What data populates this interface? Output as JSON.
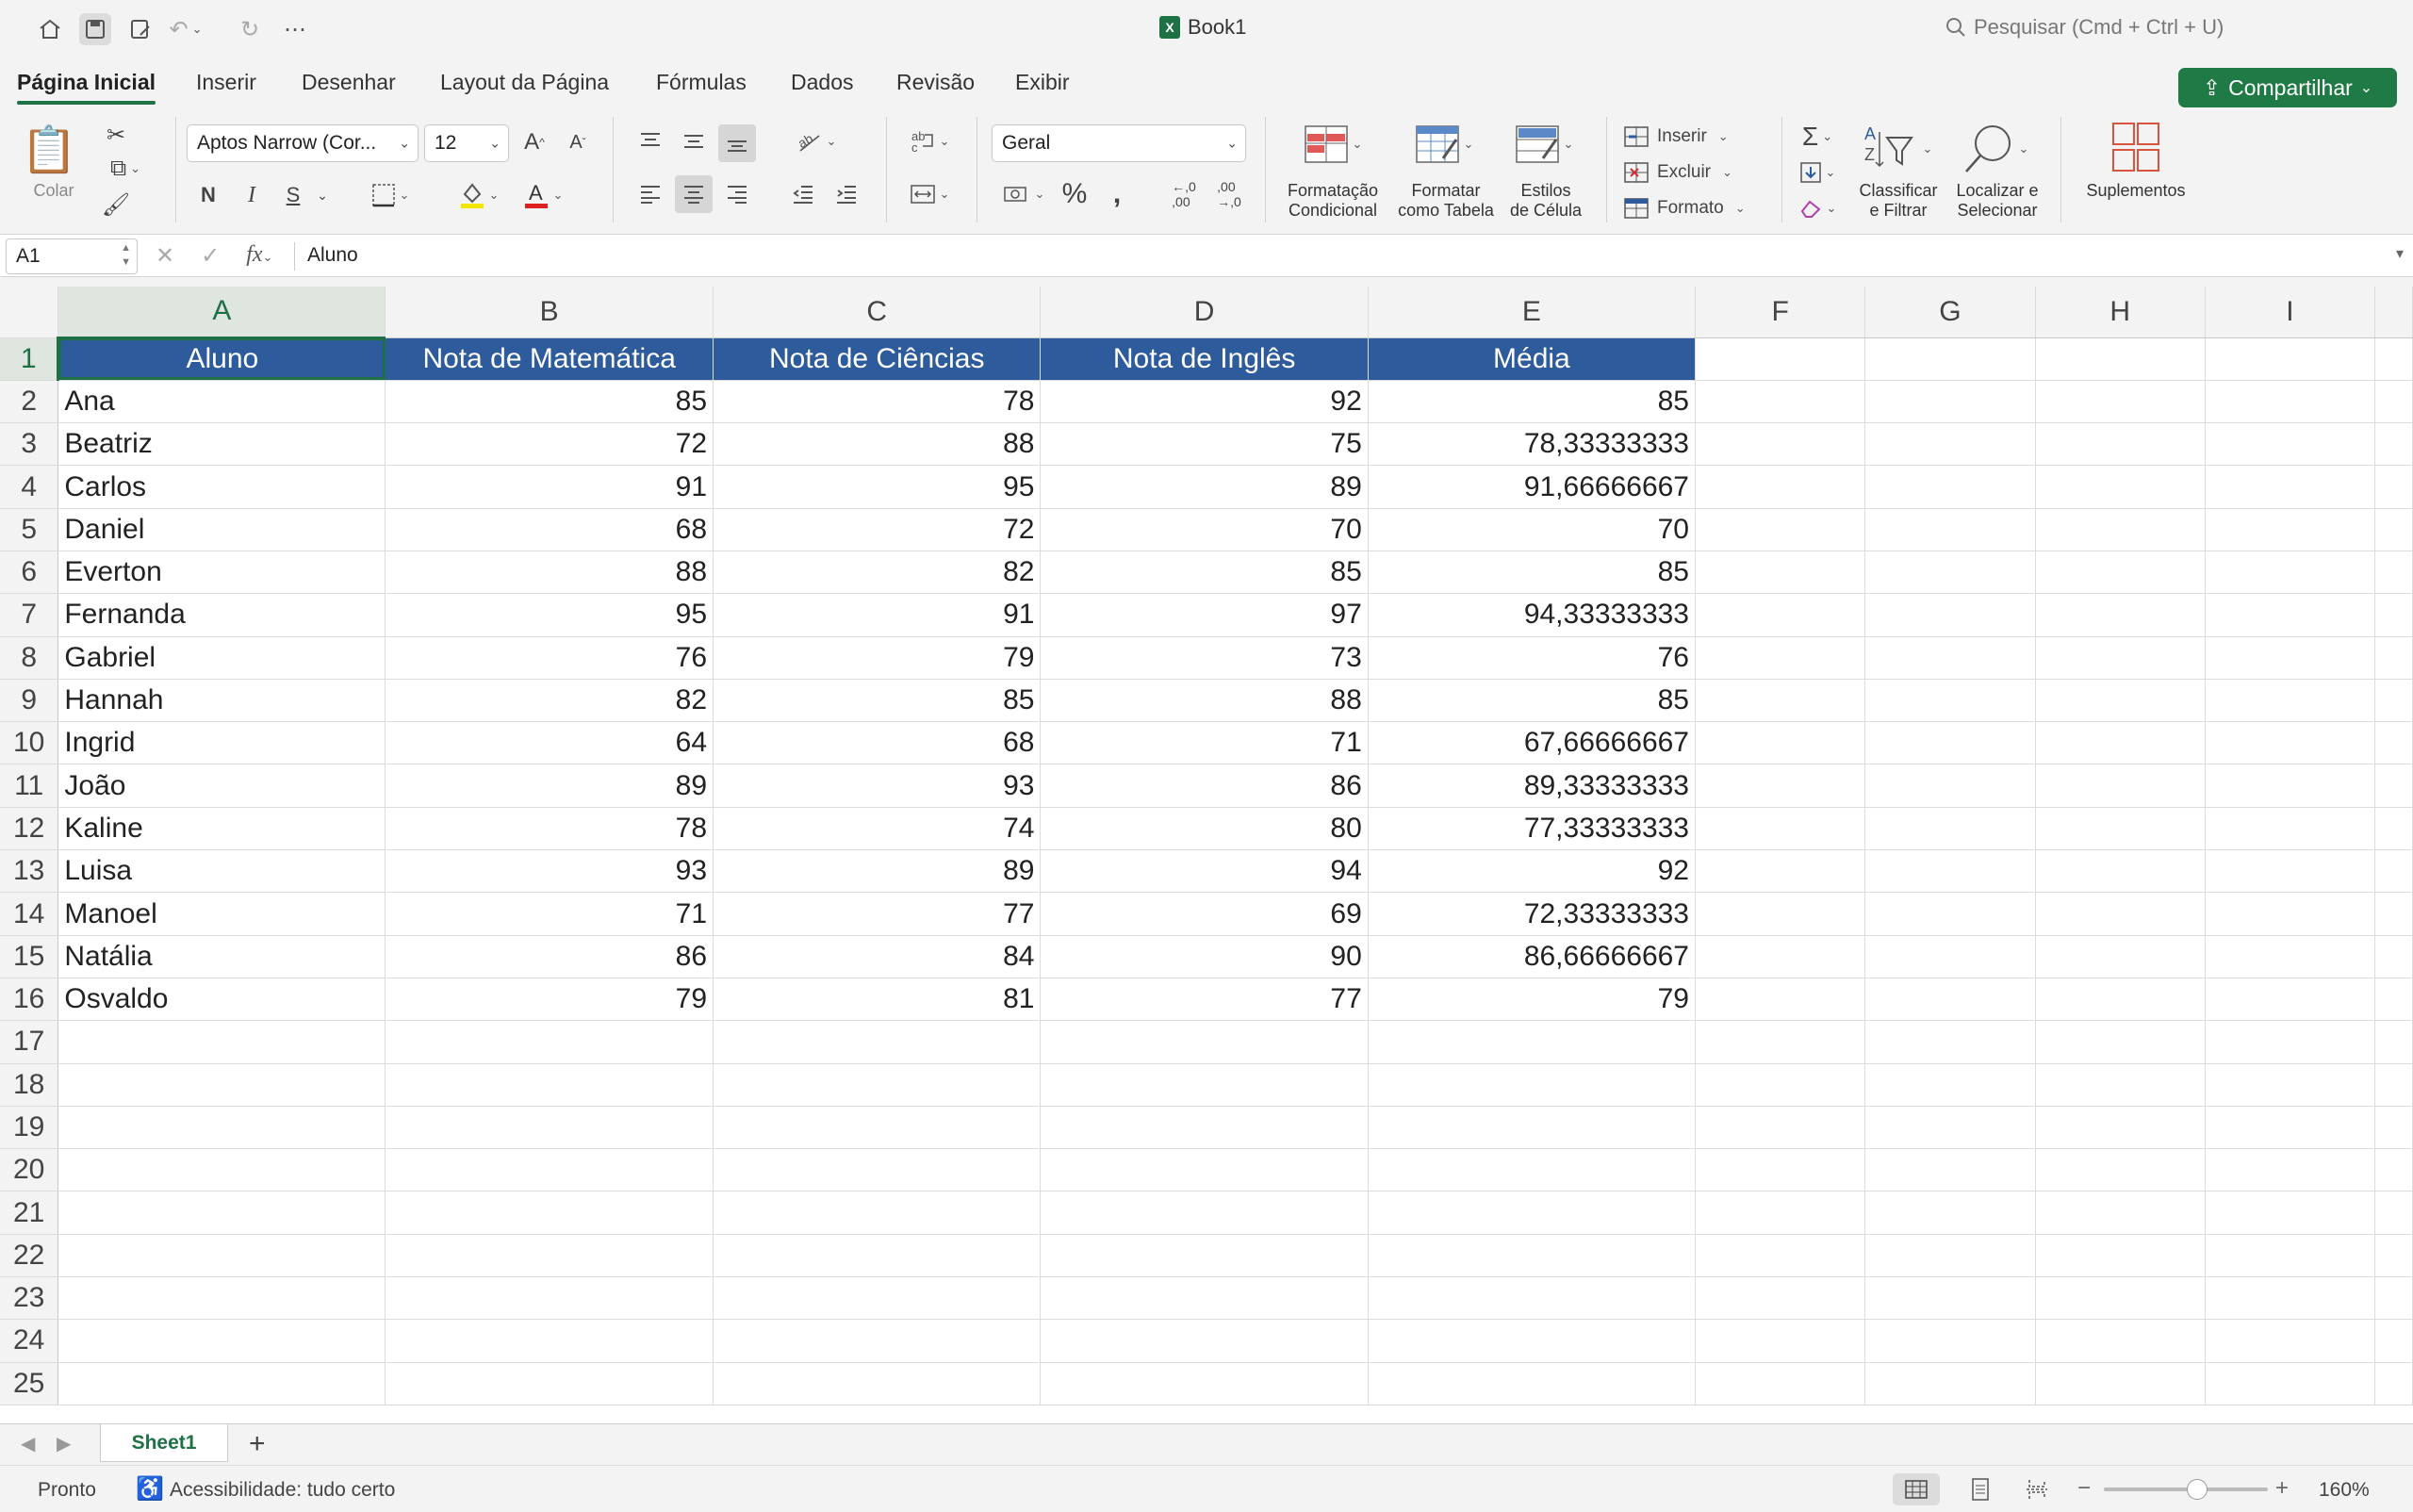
{
  "titlebar": {
    "doc_title": "Book1",
    "search_placeholder": "Pesquisar (Cmd + Ctrl + U)"
  },
  "tabs": [
    {
      "label": "Página Inicial",
      "active": true
    },
    {
      "label": "Inserir"
    },
    {
      "label": "Desenhar"
    },
    {
      "label": "Layout da Página"
    },
    {
      "label": "Fórmulas"
    },
    {
      "label": "Dados"
    },
    {
      "label": "Revisão"
    },
    {
      "label": "Exibir"
    }
  ],
  "share_label": "Compartilhar",
  "ribbon": {
    "paste_label": "Colar",
    "font_name": "Aptos Narrow (Cor...",
    "font_size": "12",
    "bold": "N",
    "italic": "I",
    "underline": "S",
    "number_format": "Geral",
    "cond_format": "Formatação\nCondicional",
    "format_table": "Formatar\ncomo Tabela",
    "cell_styles": "Estilos\nde Célula",
    "insert": "Inserir",
    "delete": "Excluir",
    "format": "Formato",
    "sort_filter": "Classificar\ne Filtrar",
    "find_select": "Localizar e\nSelecionar",
    "addins": "Suplementos"
  },
  "formula_bar": {
    "name_box": "A1",
    "content": "Aluno"
  },
  "columns": [
    "A",
    "B",
    "C",
    "D",
    "E",
    "F",
    "G",
    "H",
    "I"
  ],
  "table": {
    "headers": [
      "Aluno",
      "Nota de Matemática",
      "Nota de Ciências",
      "Nota de Inglês",
      "Média"
    ],
    "rows": [
      [
        "Ana",
        "85",
        "78",
        "92",
        "85"
      ],
      [
        "Beatriz",
        "72",
        "88",
        "75",
        "78,33333333"
      ],
      [
        "Carlos",
        "91",
        "95",
        "89",
        "91,66666667"
      ],
      [
        "Daniel",
        "68",
        "72",
        "70",
        "70"
      ],
      [
        "Everton",
        "88",
        "82",
        "85",
        "85"
      ],
      [
        "Fernanda",
        "95",
        "91",
        "97",
        "94,33333333"
      ],
      [
        "Gabriel",
        "76",
        "79",
        "73",
        "76"
      ],
      [
        "Hannah",
        "82",
        "85",
        "88",
        "85"
      ],
      [
        "Ingrid",
        "64",
        "68",
        "71",
        "67,66666667"
      ],
      [
        "João",
        "89",
        "93",
        "86",
        "89,33333333"
      ],
      [
        "Kaline",
        "78",
        "74",
        "80",
        "77,33333333"
      ],
      [
        "Luisa",
        "93",
        "89",
        "94",
        "92"
      ],
      [
        "Manoel",
        "71",
        "77",
        "69",
        "72,33333333"
      ],
      [
        "Natália",
        "86",
        "84",
        "90",
        "86,66666667"
      ],
      [
        "Osvaldo",
        "79",
        "81",
        "77",
        "79"
      ]
    ]
  },
  "row_numbers": [
    "1",
    "2",
    "3",
    "4",
    "5",
    "6",
    "7",
    "8",
    "9",
    "10",
    "11",
    "12",
    "13",
    "14",
    "15",
    "16",
    "17",
    "18",
    "19",
    "20",
    "21",
    "22",
    "23",
    "24",
    "25"
  ],
  "sheet_tab": "Sheet1",
  "status": {
    "ready": "Pronto",
    "accessibility": "Acessibilidade: tudo certo",
    "zoom": "160%"
  },
  "colors": {
    "accent": "#1e7145",
    "header_fill": "#2d5b9b"
  }
}
